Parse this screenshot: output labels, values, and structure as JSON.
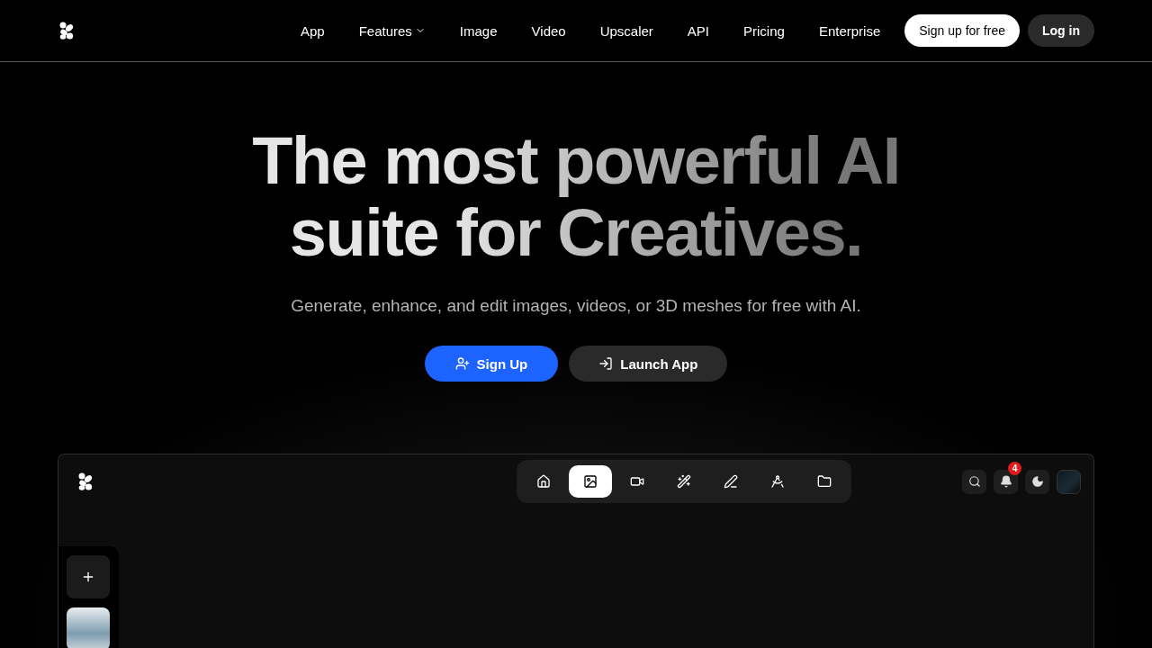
{
  "nav": {
    "links": [
      {
        "label": "App",
        "dropdown": false
      },
      {
        "label": "Features",
        "dropdown": true
      },
      {
        "label": "Image",
        "dropdown": false
      },
      {
        "label": "Video",
        "dropdown": false
      },
      {
        "label": "Upscaler",
        "dropdown": false
      },
      {
        "label": "API",
        "dropdown": false
      },
      {
        "label": "Pricing",
        "dropdown": false
      },
      {
        "label": "Enterprise",
        "dropdown": false
      }
    ],
    "signup": "Sign up for free",
    "login": "Log in"
  },
  "hero": {
    "title_lines": [
      "The most powerful AI",
      "suite for Creatives."
    ],
    "subtitle": "Generate, enhance, and edit images, videos, or 3D meshes for free with AI.",
    "buttons": [
      {
        "label": "Sign Up",
        "kind": "primary"
      },
      {
        "label": "Launch App",
        "kind": "secondary"
      }
    ]
  },
  "app": {
    "tools": [
      {
        "kind": "home",
        "selected": false
      },
      {
        "kind": "image",
        "selected": true
      },
      {
        "kind": "video",
        "selected": false
      },
      {
        "kind": "wand",
        "selected": false
      },
      {
        "kind": "pen",
        "selected": false
      },
      {
        "kind": "compass",
        "selected": false
      },
      {
        "kind": "folder",
        "selected": false
      }
    ],
    "notifications": "4"
  }
}
